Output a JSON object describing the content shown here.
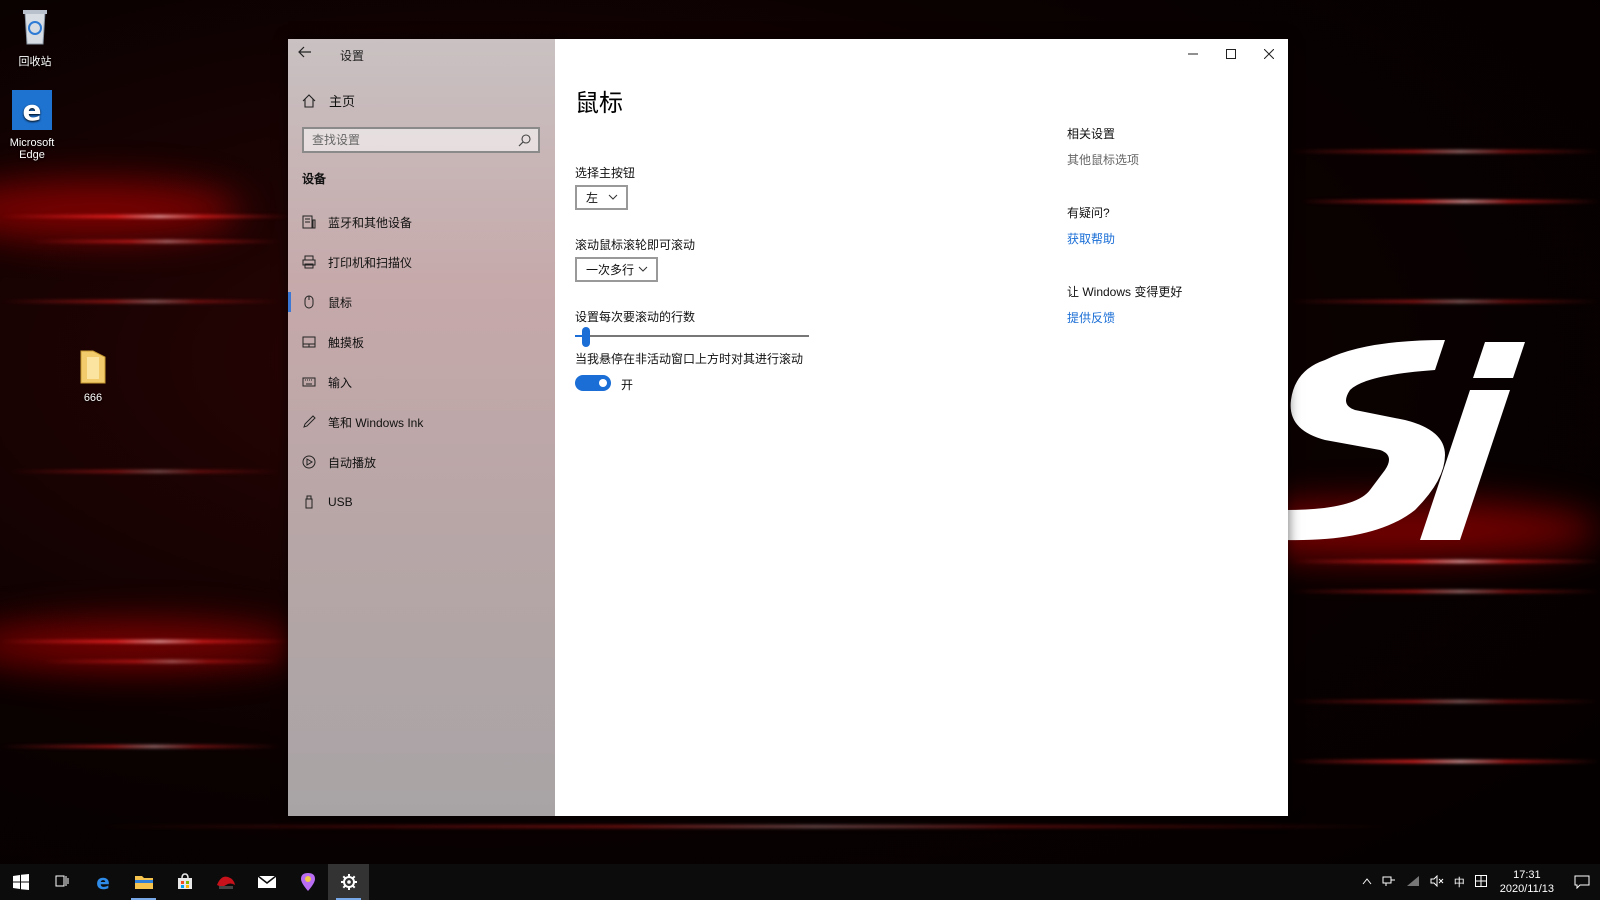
{
  "desktop": {
    "icons": [
      {
        "name": "回收站",
        "icon": "recycle-bin-icon"
      },
      {
        "name": "Microsoft Edge",
        "icon": "edge-icon"
      },
      {
        "name": "666",
        "icon": "folder-icon"
      }
    ],
    "accent": "#e01010"
  },
  "window": {
    "title": "设置",
    "sidebar": {
      "home_label": "主页",
      "search_placeholder": "查找设置",
      "section_title": "设备",
      "items": [
        {
          "label": "蓝牙和其他设备",
          "icon": "bluetooth-devices-icon"
        },
        {
          "label": "打印机和扫描仪",
          "icon": "printer-icon"
        },
        {
          "label": "鼠标",
          "icon": "mouse-icon",
          "selected": true
        },
        {
          "label": "触摸板",
          "icon": "touchpad-icon"
        },
        {
          "label": "输入",
          "icon": "keyboard-icon"
        },
        {
          "label": "笔和 Windows Ink",
          "icon": "pen-icon"
        },
        {
          "label": "自动播放",
          "icon": "autoplay-icon"
        },
        {
          "label": "USB",
          "icon": "usb-icon"
        }
      ]
    },
    "main": {
      "page_title": "鼠标",
      "primary_button_label": "选择主按钮",
      "primary_button_value": "左",
      "wheel_label": "滚动鼠标滚轮即可滚动",
      "wheel_value": "一次多行",
      "lines_label": "设置每次要滚动的行数",
      "lines_slider_fraction": 0.03,
      "inactive_scroll_label": "当我悬停在非活动窗口上方时对其进行滚动",
      "inactive_scroll_state": "开"
    },
    "related": {
      "related_heading": "相关设置",
      "more_mouse_options": "其他鼠标选项",
      "question_heading": "有疑问?",
      "get_help": "获取帮助",
      "improve_heading": "让 Windows 变得更好",
      "give_feedback": "提供反馈"
    },
    "accent_color": "#1a6ed6"
  },
  "taskbar": {
    "apps": [
      "start-icon",
      "task-view-icon",
      "edge-icon",
      "file-explorer-icon",
      "store-icon",
      "msi-dragon-icon",
      "mail-icon",
      "maps-icon",
      "settings-icon"
    ],
    "tray": {
      "input_method": "中",
      "time": "17:31",
      "date": "2020/11/13"
    }
  }
}
